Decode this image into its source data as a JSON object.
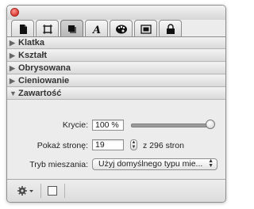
{
  "tabs": [
    {
      "icon": "document-icon",
      "active": false
    },
    {
      "icon": "frame-icon",
      "active": false
    },
    {
      "icon": "square-shadow-icon",
      "active": true
    },
    {
      "icon": "text-a-icon",
      "active": false
    },
    {
      "icon": "palette-icon",
      "active": false
    },
    {
      "icon": "image-frame-icon",
      "active": false
    },
    {
      "icon": "lock-icon",
      "active": false
    }
  ],
  "sections": [
    {
      "label": "Klatka",
      "expanded": false
    },
    {
      "label": "Kształt",
      "expanded": false
    },
    {
      "label": "Obrysowana",
      "expanded": false
    },
    {
      "label": "Cieniowanie",
      "expanded": false
    },
    {
      "label": "Zawartość",
      "expanded": true
    }
  ],
  "content": {
    "opacity_label": "Krycie:",
    "opacity_value": "100 %",
    "opacity_level": 1.0,
    "page_label": "Pokaż stronę:",
    "page_value": "19",
    "page_total": "z 296 stron",
    "blend_label": "Tryb mieszania:",
    "blend_value": "Użyj domyślnego typu mie..."
  },
  "bottom": {
    "gear_icon": "gear-icon",
    "view_icon": "square-icon"
  },
  "colors": {
    "close_button": "#d9382f",
    "panel_bg": "#ececec"
  }
}
